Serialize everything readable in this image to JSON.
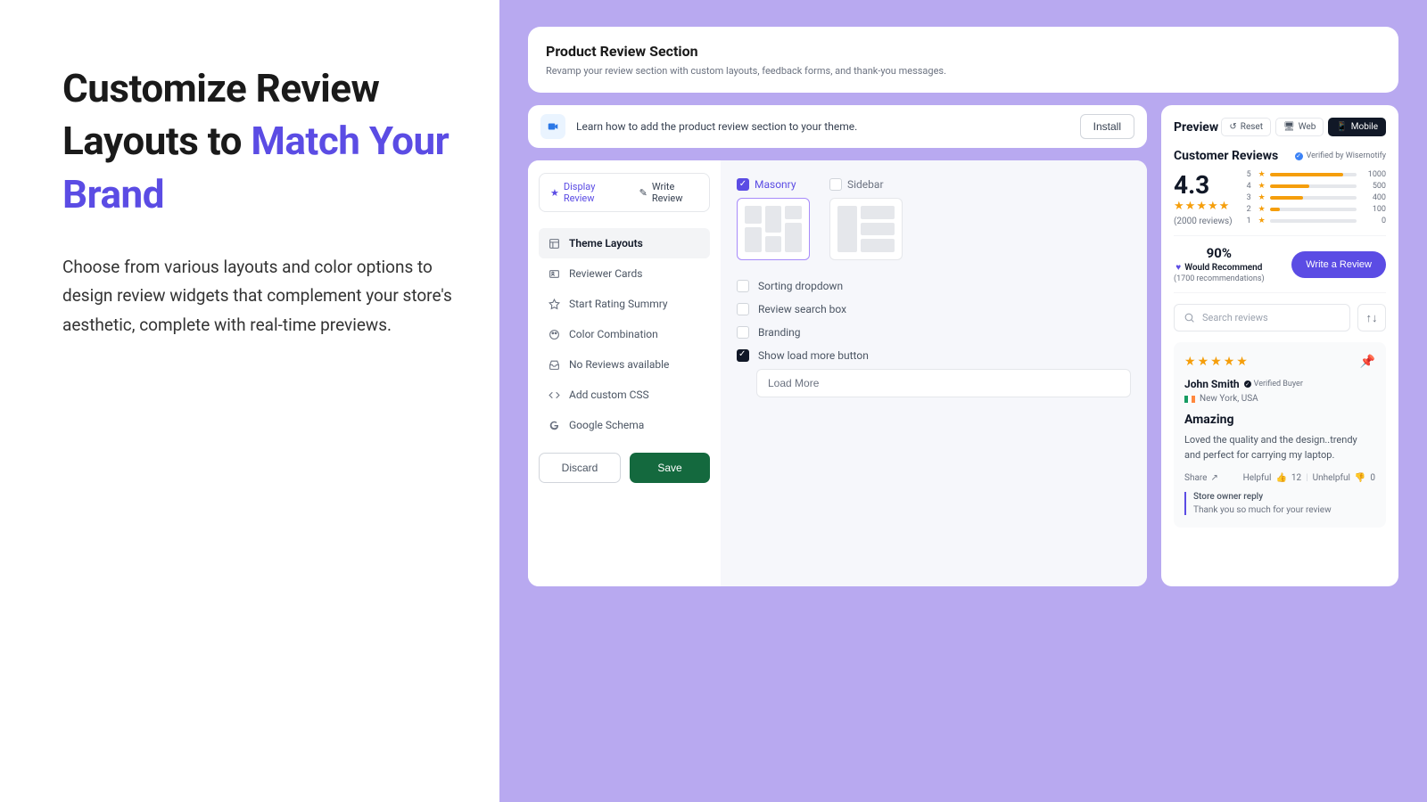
{
  "hero": {
    "title_prefix": "Customize Review Layouts to ",
    "title_accent": "Match Your Brand",
    "subtitle": "Choose from various layouts and color options to design review widgets that complement your store's aesthetic, complete with real-time previews."
  },
  "header": {
    "title": "Product Review Section",
    "subtitle": "Revamp your review section with custom layouts, feedback forms, and thank-you messages."
  },
  "info": {
    "text": "Learn how to add the product review section to your theme.",
    "install": "Install"
  },
  "tabs": {
    "display": "Display Review",
    "write": "Write Review"
  },
  "menu": [
    "Theme Layouts",
    "Reviewer Cards",
    "Start Rating Summry",
    "Color Combination",
    "No Reviews available",
    "Add custom CSS",
    "Google Schema"
  ],
  "actions": {
    "discard": "Discard",
    "save": "Save"
  },
  "layouts": {
    "masonry": "Masonry",
    "sidebar": "Sidebar"
  },
  "options": {
    "sorting": "Sorting dropdown",
    "search": "Review search box",
    "branding": "Branding",
    "loadmore": "Show load more button",
    "loadmore_value": "Load More"
  },
  "preview": {
    "title": "Preview",
    "reset": "Reset",
    "web": "Web",
    "mobile": "Mobile",
    "cr_title": "Customer Reviews",
    "verified": "Verified by Wisernotify",
    "rating": "4.3",
    "count": "(2000 reviews)",
    "bars": [
      {
        "n": "5",
        "cnt": "1000",
        "pct": 85
      },
      {
        "n": "4",
        "cnt": "500",
        "pct": 45
      },
      {
        "n": "3",
        "cnt": "400",
        "pct": 38
      },
      {
        "n": "2",
        "cnt": "100",
        "pct": 12
      },
      {
        "n": "1",
        "cnt": "0",
        "pct": 0
      }
    ],
    "recommend_pct": "90%",
    "recommend_label": "Would Recommend",
    "recommend_sub": "(1700 recommendations)",
    "write_btn": "Write a Review",
    "search_placeholder": "Search reviews",
    "review": {
      "name": "John Smith",
      "verified": "Verified Buyer",
      "location": "New York, USA",
      "title": "Amazing",
      "body": "Loved the quality and the design..trendy and perfect for carrying my laptop.",
      "share": "Share",
      "helpful": "Helpful",
      "helpful_n": "12",
      "unhelpful": "Unhelpful",
      "unhelpful_n": "0",
      "owner_h": "Store owner reply",
      "owner_body": "Thank you so much for your review"
    }
  }
}
